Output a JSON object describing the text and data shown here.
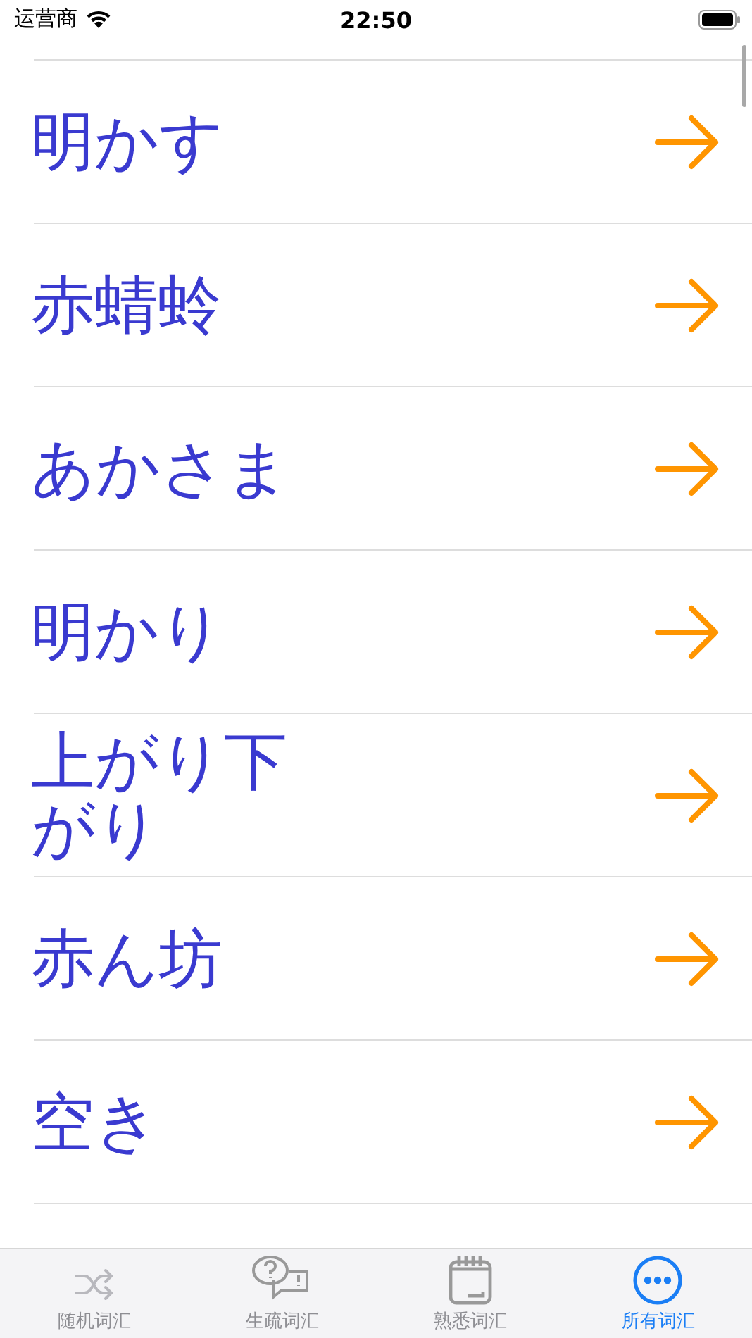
{
  "status_bar": {
    "carrier": "运营商",
    "time": "22:50"
  },
  "words": [
    {
      "text": "明かす"
    },
    {
      "text": "赤蜻蛉"
    },
    {
      "text": "あかさま"
    },
    {
      "text": "明かり"
    },
    {
      "text": "上がり下がり"
    },
    {
      "text": "赤ん坊"
    },
    {
      "text": "空き"
    }
  ],
  "tab_bar": [
    {
      "label": "随机词汇",
      "kind": "shuffle",
      "selected": false
    },
    {
      "label": "生疏词汇",
      "kind": "question",
      "selected": false
    },
    {
      "label": "熟悉词汇",
      "kind": "notepad",
      "selected": false
    },
    {
      "label": "所有词汇",
      "kind": "more",
      "selected": true
    }
  ]
}
